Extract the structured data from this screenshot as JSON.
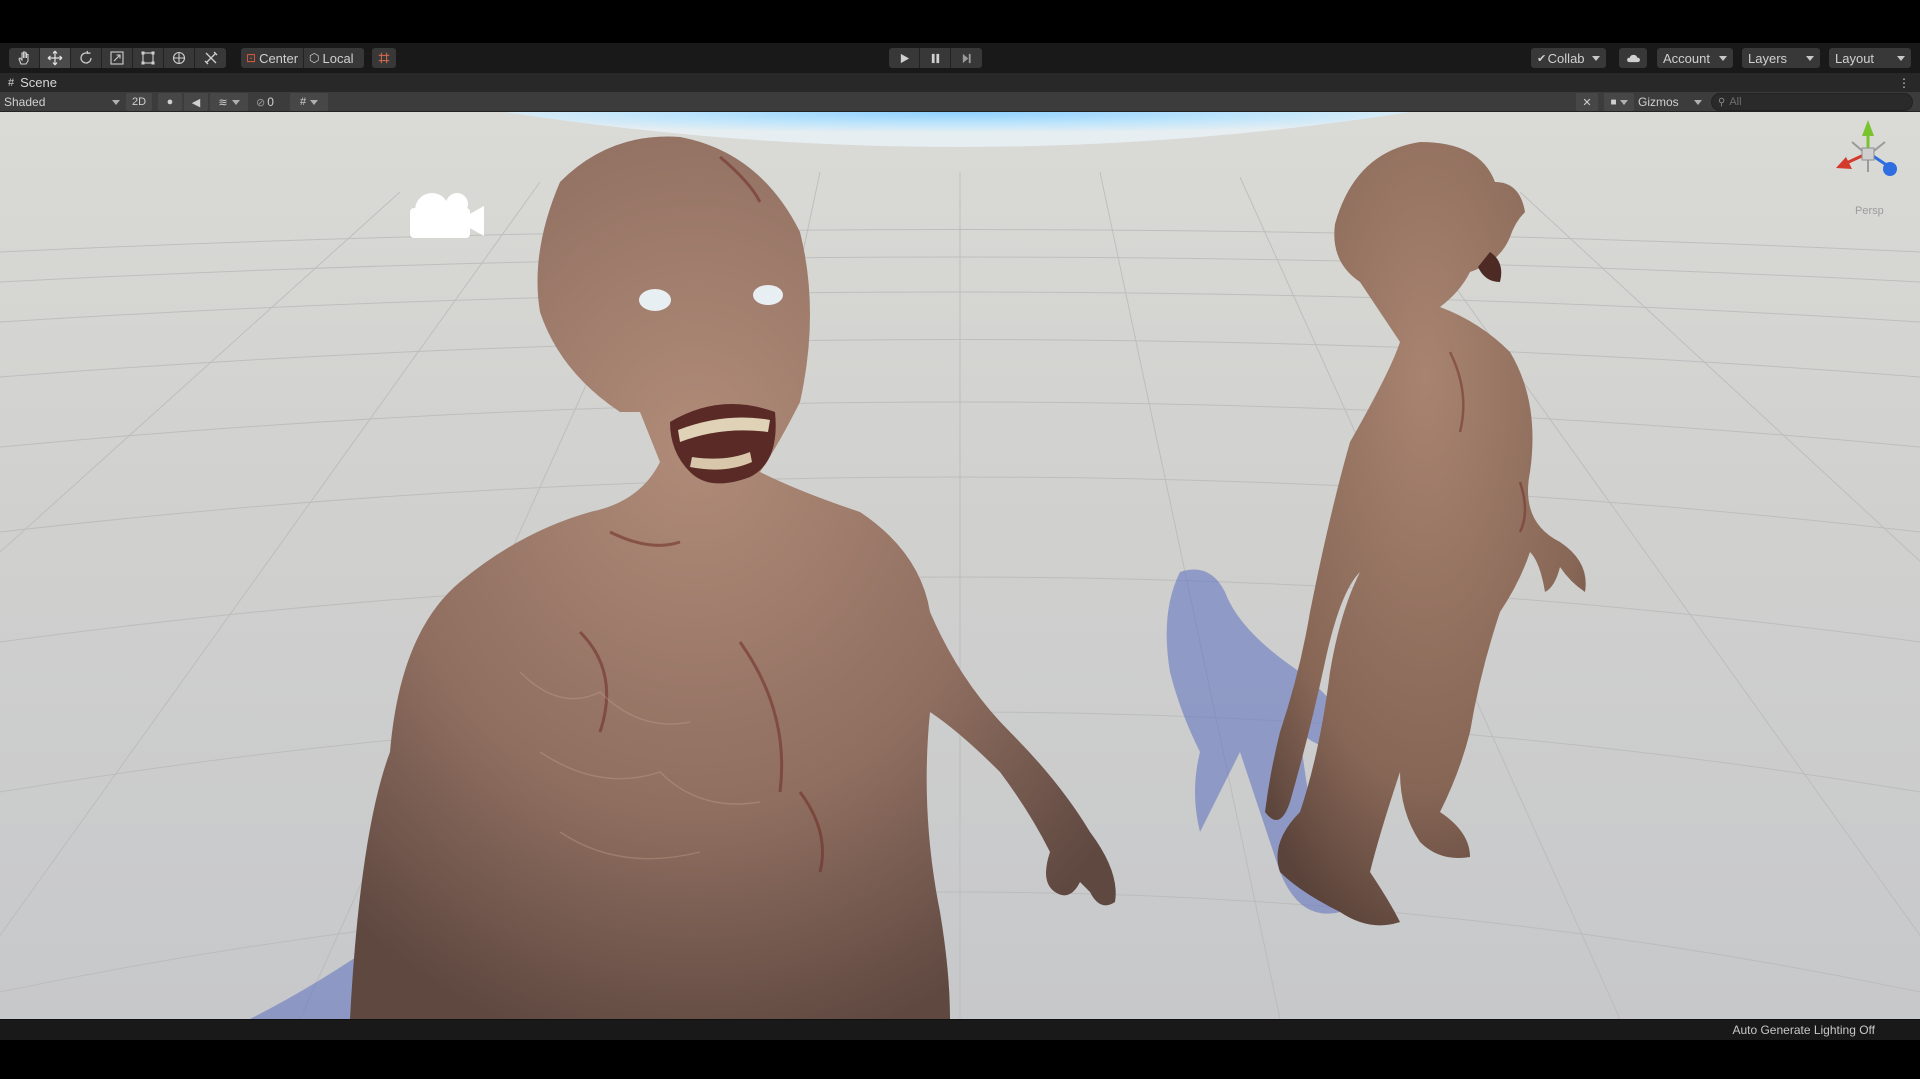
{
  "toolbar": {
    "tools": [
      "hand-tool",
      "move-tool",
      "rotate-tool",
      "scale-tool",
      "rect-tool",
      "transform-tool",
      "custom-tool"
    ],
    "pivot_center_label": "Center",
    "pivot_local_label": "Local",
    "collab_label": "Collab",
    "account_label": "Account",
    "layers_label": "Layers",
    "layout_label": "Layout"
  },
  "tab": {
    "title": "Scene"
  },
  "scene_bar": {
    "draw_mode": "Shaded",
    "mode_2d": "2D",
    "hidden_count": "0",
    "gizmos_label": "Gizmos",
    "search_placeholder": "All"
  },
  "gizmo": {
    "projection_label": "Persp"
  },
  "status": {
    "lighting_text": "Auto Generate Lighting Off"
  },
  "colors": {
    "toolbar_bg": "#191919",
    "button_bg": "#383838",
    "panel_bg": "#282828",
    "scenebar_bg": "#3c3c3c",
    "ground": "#cfcfcf",
    "skin": "#9a7868",
    "gizmo_x": "#d33a2c",
    "gizmo_y": "#79c32f",
    "gizmo_z": "#2e6ee0"
  }
}
